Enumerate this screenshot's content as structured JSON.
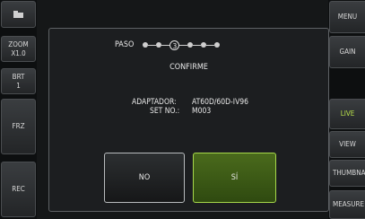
{
  "left_panel": {
    "zoom_label": "ZOOM",
    "zoom_value": "X1.0",
    "brt_label": "BRT",
    "brt_value": "1",
    "frz_label": "FRZ",
    "rec_label": "REC"
  },
  "right_panel": {
    "menu_label": "MENU",
    "gain_label": "GAIN",
    "live_label": "LIVE",
    "view_label": "VIEW",
    "thumbnail_label": "THUMBNA",
    "measure_label": "MEASURE"
  },
  "dialog": {
    "step_label": "PASO",
    "current_step": "3",
    "title": "CONFIRME",
    "adapter_label": "ADAPTADOR:",
    "adapter_value": "AT60D/60D-IV96",
    "set_no_label": "SET NO.:",
    "set_no_value": "M003",
    "no_button": "NO",
    "yes_button": "SÍ"
  },
  "colors": {
    "accent": "#b8e04a",
    "yes_button_bg": "#3d5a16"
  },
  "icons": {
    "top_left": "folder-icon"
  }
}
